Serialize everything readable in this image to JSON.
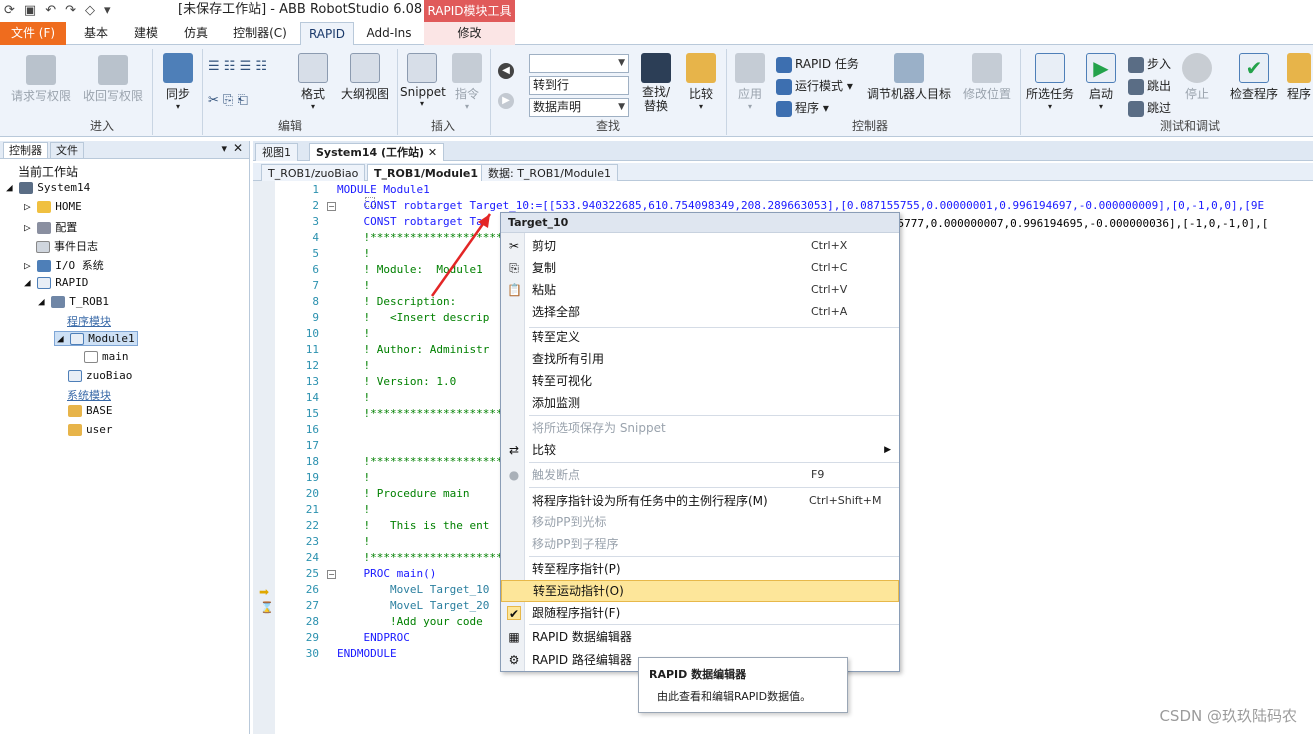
{
  "titlebar": {
    "title": "[未保存工作站] - ABB RobotStudio 6.08",
    "context_group": "RAPID模块工具"
  },
  "tabs": [
    "文件 (F)",
    "基本",
    "建模",
    "仿真",
    "控制器(C)",
    "RAPID",
    "Add-Ins",
    "修改"
  ],
  "ribbon": {
    "btn_req_write": "请求写权限",
    "btn_release_write": "收回写权限",
    "btn_sync": "同步",
    "grp_enter": "进入",
    "btn_format": "格式",
    "btn_outline": "大纲视图",
    "grp_edit": "编辑",
    "btn_snippet": "Snippet",
    "btn_instruction": "指令",
    "grp_insert": "插入",
    "goto_line": "转到行",
    "data_decl": "数据声明",
    "btn_find_replace": "查找/\n替换",
    "btn_compare": "比较",
    "grp_find": "查找",
    "btn_apply": "应用",
    "rapid_task": "RAPID 任务",
    "run_mode": "运行模式",
    "program": "程序",
    "btn_adjust_target": "调节机器人目标",
    "btn_modify_pos": "修改位置",
    "grp_controller": "控制器",
    "btn_selected_tasks": "所选任务",
    "btn_start": "启动",
    "step_in": "步入",
    "step_out": "跳出",
    "step_over": "跳过",
    "btn_stop": "停止",
    "btn_check": "检查程序",
    "btn_program_more": "程序",
    "grp_test": "测试和调试"
  },
  "left": {
    "tab_controller": "控制器",
    "tab_file": "文件",
    "current_station": "当前工作站",
    "tree": [
      "System14",
      "HOME",
      "配置",
      "事件日志",
      "I/O 系统",
      "RAPID",
      "T_ROB1",
      "程序模块",
      "Module1",
      "main",
      "zuoBiao",
      "系统模块",
      "BASE",
      "user"
    ]
  },
  "doctabs": [
    "视图1",
    "System14 (工作站)"
  ],
  "subtabs": [
    "T_ROB1/zuoBiao",
    "T_ROB1/Module1",
    "数据: T_ROB1/Module1"
  ],
  "code": [
    "MODULE Module1",
    "    CONST robtarget Target_10:=[[533.940322685,610.754098349,208.289663053],[0.087155755,0.00000001,0.996194697,-0.000000009],[0,-1,0,0],[9E",
    "    CONST robtarget Tar",
    "    !***************************",
    "    !",
    "    ! Module:  Module1",
    "    !",
    "    ! Description:",
    "    !   <Insert descrip",
    "    !",
    "    ! Author: Administr",
    "    !",
    "    ! Version: 1.0",
    "    !",
    "    !***************************",
    "",
    "",
    "    !***************************",
    "    !",
    "    ! Procedure main",
    "    !",
    "    !   This is the ent",
    "    !",
    "    !***************************",
    "    PROC main()",
    "        MoveL Target_10",
    "        MoveL Target_20",
    "        !Add your code",
    "    ENDPROC",
    "ENDMODULE"
  ],
  "code_tail_line3": "87155777,0.000000007,0.996194695,-0.000000036],[-1,0,-1,0],[",
  "menu": {
    "header": "Target_10",
    "items": [
      "剪切",
      "复制",
      "粘贴",
      "选择全部",
      "转至定义",
      "查找所有引用",
      "转至可视化",
      "添加监测",
      "将所选项保存为 Snippet",
      "比较",
      "触发断点",
      "将程序指针设为所有任务中的主例行程序(M)",
      "移动PP到光标",
      "移动PP到子程序",
      "转至程序指针(P)",
      "转至运动指针(O)",
      "跟随程序指针(F)",
      "RAPID 数据编辑器",
      "RAPID 路径编辑器"
    ],
    "shortcuts": [
      "Ctrl+X",
      "Ctrl+C",
      "Ctrl+V",
      "Ctrl+A",
      "F9",
      "Ctrl+Shift+M"
    ]
  },
  "tooltip": {
    "title": "RAPID 数据编辑器",
    "body": "由此查看和编辑RAPID数据值。"
  },
  "watermark": "CSDN @玖玖陆码农"
}
